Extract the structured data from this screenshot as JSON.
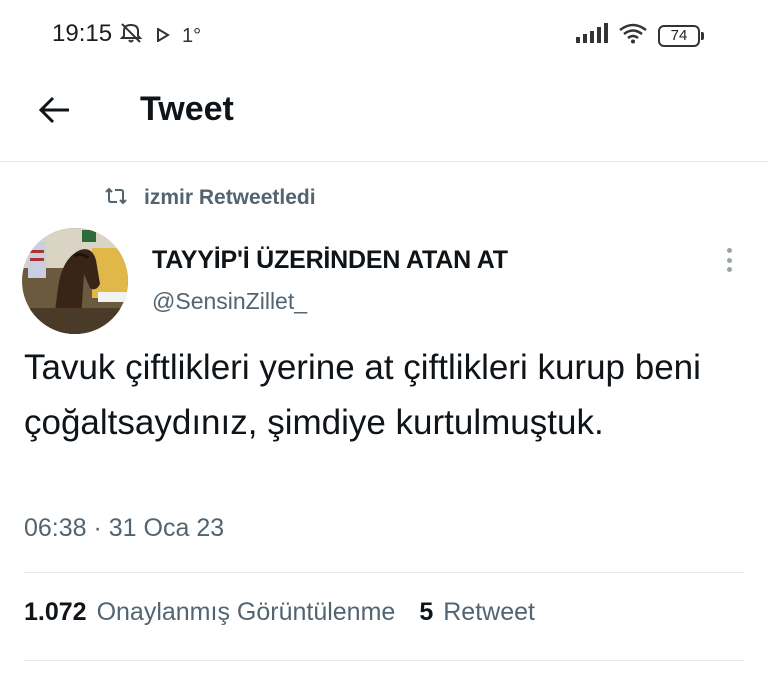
{
  "status_bar": {
    "time": "19:15",
    "temperature": "1°",
    "battery": "74",
    "icons": [
      "mute-icon",
      "play-icon",
      "signal-icon",
      "wifi-icon",
      "battery-icon"
    ]
  },
  "header": {
    "title": "Tweet",
    "back_icon": "arrow-left-icon"
  },
  "tweet": {
    "retweeted_by": "izmir Retweetledi",
    "author": {
      "name": "TAYYİP'İ ÜZERİNDEN ATAN AT",
      "handle": "@SensinZillet_"
    },
    "text": "Tavuk çiftlikleri yerine at çiftlikleri kurup beni çoğaltsaydınız, şimdiye kurtulmuştuk.",
    "timestamp": "06:38 · 31 Oca 23",
    "stats": {
      "views_count": "1.072",
      "views_label": "Onaylanmış Görüntülenme",
      "retweets_count": "5",
      "retweets_label": "Retweet"
    }
  },
  "colors": {
    "text_primary": "#0f1419",
    "text_secondary": "#536471",
    "divider": "#e7e9ea"
  }
}
